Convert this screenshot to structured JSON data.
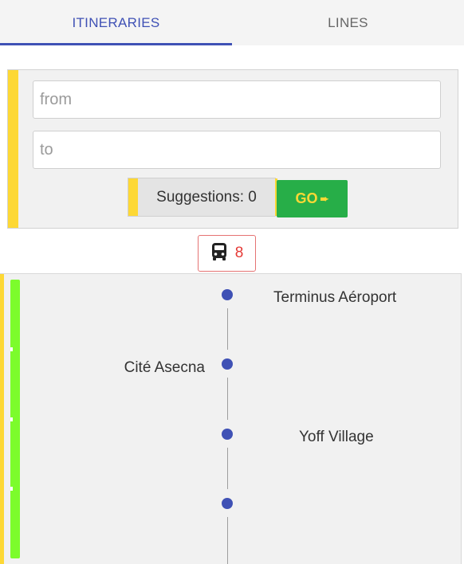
{
  "tabs": {
    "itineraries": "ITINERARIES",
    "lines": "LINES"
  },
  "search": {
    "from_placeholder": "from",
    "to_placeholder": "to",
    "from_value": "",
    "to_value": "",
    "suggestions_label": "Suggestions: 0",
    "go_label": "GO",
    "go_icon": "arrow-right-icon"
  },
  "bus_badge": {
    "icon": "bus-icon",
    "count": "8"
  },
  "route": {
    "stops": [
      {
        "name": "Terminus Aéroport",
        "side": "right"
      },
      {
        "name": "Cité Asecna",
        "side": "left"
      },
      {
        "name": "Yoff Village",
        "side": "right"
      },
      {
        "name": "",
        "side": "left"
      }
    ]
  },
  "colors": {
    "accent_blue": "#3f51b5",
    "accent_yellow": "#fdd835",
    "go_green": "#27ae48",
    "line_green": "#7cfc2c",
    "badge_red": "#e53935"
  }
}
